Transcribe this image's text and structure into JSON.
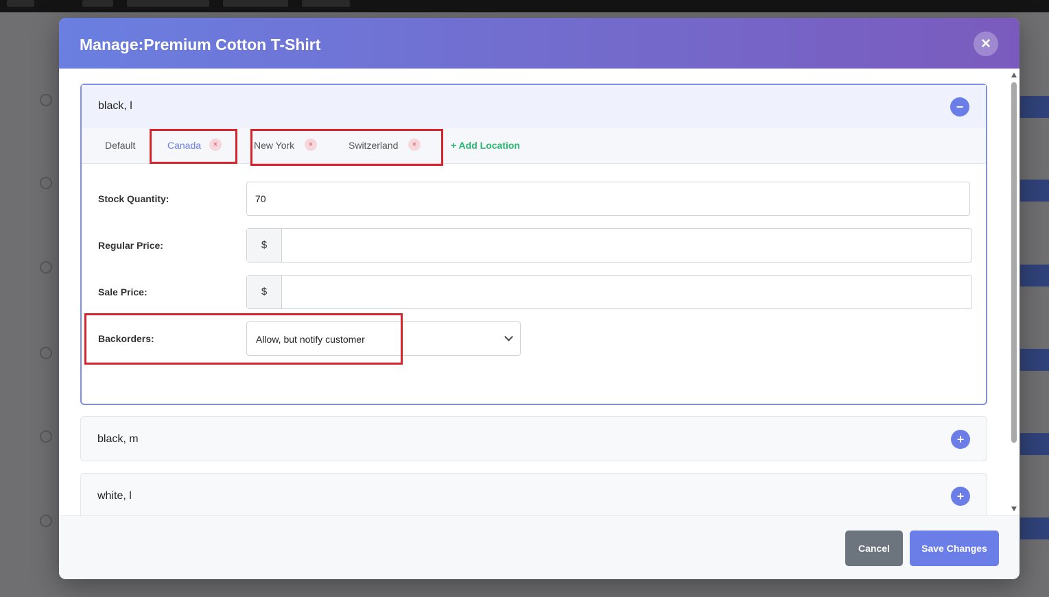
{
  "modal": {
    "title": "Manage:Premium Cotton T-Shirt",
    "close_label": "×"
  },
  "variations": [
    {
      "name": "black, l",
      "expanded": true,
      "toggle_label": "−",
      "tabs": [
        {
          "label": "Default",
          "removable": false,
          "active": false
        },
        {
          "label": "Canada",
          "removable": true,
          "active": true
        },
        {
          "label": "New York",
          "removable": true,
          "active": false
        },
        {
          "label": "Switzerland",
          "removable": true,
          "active": false
        }
      ],
      "remove_label": "×",
      "add_location_label": "+ Add Location",
      "fields": {
        "stock_quantity": {
          "label": "Stock Quantity:",
          "value": "70"
        },
        "regular_price": {
          "label": "Regular Price:",
          "prefix": "$",
          "value": ""
        },
        "sale_price": {
          "label": "Sale Price:",
          "prefix": "$",
          "value": ""
        },
        "backorders": {
          "label": "Backorders:",
          "value": "Allow, but notify customer"
        }
      }
    },
    {
      "name": "black, m",
      "expanded": false,
      "toggle_label": "+"
    },
    {
      "name": "white, l",
      "expanded": false,
      "toggle_label": "+"
    }
  ],
  "footer": {
    "cancel_label": "Cancel",
    "save_label": "Save Changes"
  },
  "colors": {
    "header_gradient_start": "#6a7fe0",
    "header_gradient_end": "#7a5bbd",
    "accent": "#6b7ee8",
    "add_location": "#2bb673",
    "remove": "#e04856",
    "highlight": "#d8232a",
    "cancel": "#6c757d"
  }
}
